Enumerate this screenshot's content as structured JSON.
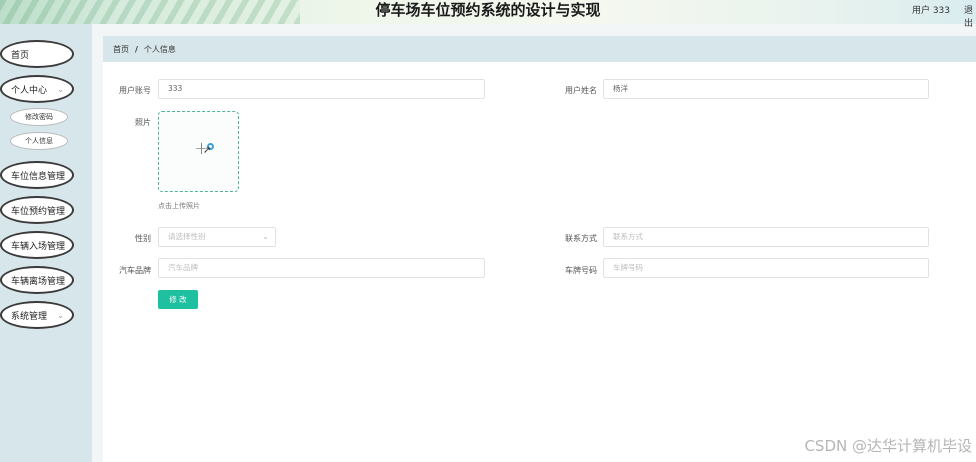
{
  "header": {
    "title": "停车场车位预约系统的设计与实现",
    "user_label": "用户 333",
    "logout_label": "退出"
  },
  "sidebar": {
    "items": [
      {
        "label": "首页"
      },
      {
        "label": "个人中心"
      },
      {
        "label": "车位信息管理"
      },
      {
        "label": "车位预约管理"
      },
      {
        "label": "车辆入场管理"
      },
      {
        "label": "车辆离场管理"
      },
      {
        "label": "系统管理"
      }
    ],
    "sub_items": [
      {
        "label": "修改密码"
      },
      {
        "label": "个人信息"
      }
    ],
    "chevron_icon": "chevron-down-icon"
  },
  "breadcrumb": {
    "home": "首页",
    "separator": "/",
    "current": "个人信息"
  },
  "form": {
    "username_label": "用户账号",
    "username_value": "333",
    "realname_label": "用户姓名",
    "realname_value": "杨洋",
    "photo_label": "照片",
    "upload_hint": "点击上传照片",
    "gender_label": "性别",
    "gender_placeholder": "请选择性别",
    "contact_label": "联系方式",
    "contact_placeholder": "联系方式",
    "brand_label": "汽车品牌",
    "brand_placeholder": "汽车品牌",
    "plate_label": "车牌号码",
    "plate_placeholder": "车牌号码",
    "submit_label": "修 改"
  },
  "watermark": "CSDN @达华计算机毕设",
  "colors": {
    "accent": "#1ec0a0",
    "sidebar_bg": "#d7e6ea",
    "upload_border": "#4fb39d"
  }
}
